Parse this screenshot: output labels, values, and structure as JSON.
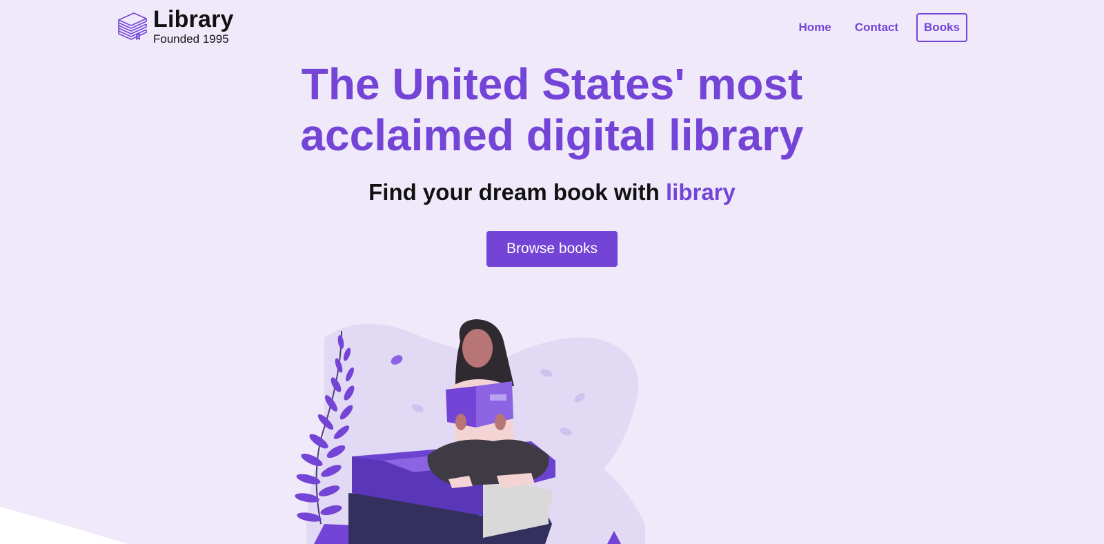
{
  "header": {
    "brand_title": "Library",
    "brand_subtitle": "Founded 1995",
    "brand_icon": "stacked-books-icon",
    "nav": [
      {
        "label": "Home"
      },
      {
        "label": "Contact"
      },
      {
        "label": "Books"
      }
    ]
  },
  "hero": {
    "title_line1": "The United States' most",
    "title_line2": "acclaimed digital library",
    "subtitle_prefix": "Find your dream book with ",
    "subtitle_accent": "library",
    "cta_label": "Browse books"
  },
  "colors": {
    "accent": "#7344d6",
    "background": "#efe9fa",
    "text": "#111111"
  }
}
